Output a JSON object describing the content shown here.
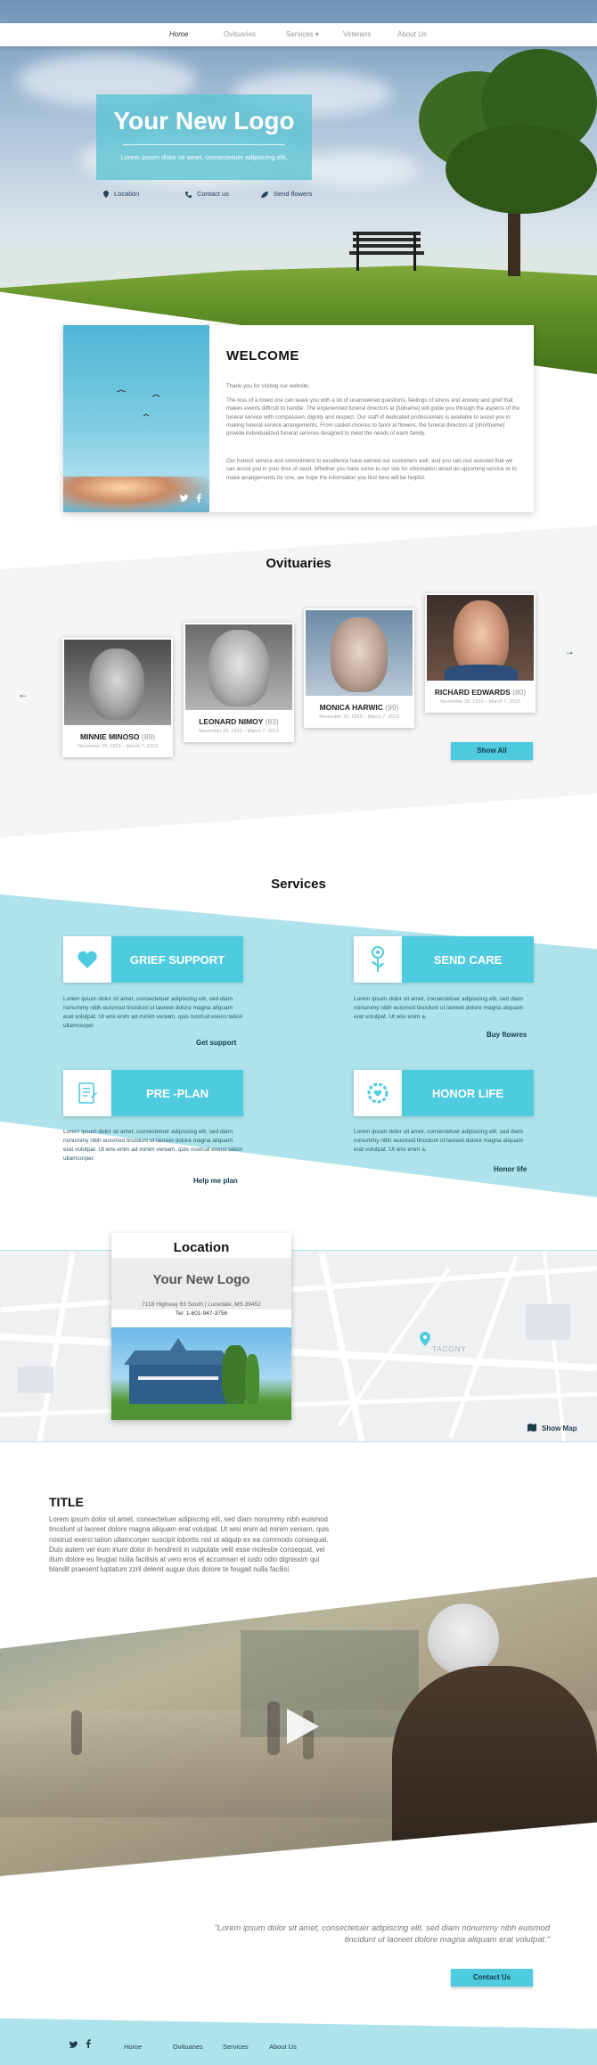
{
  "nav": {
    "items": [
      "Home",
      "Ovituaries",
      "Services",
      "Veterans",
      "About Us"
    ],
    "services_caret": "▾"
  },
  "hero": {
    "logo_title": "Your New Logo",
    "logo_subtitle": "Lorem ipsum dolor sit amet, consectetuer adipiscing elit,",
    "links": [
      "Location",
      "Contact us",
      "Send flowers"
    ]
  },
  "welcome": {
    "title": "WELCOME",
    "p1": "Thank you for visiting our website.",
    "p2": "The loss of a loved one can leave you with a lot of unanswered questions, feelings of stress and anxiety and grief that makes events difficult to handle. The experienced funeral directors at [fullname] will guide you through the aspects of the funeral service with compassion, dignity and respect. Our staff of dedicated professionals is available to assist you in making funeral service arrangements. From casket choices to fanor al flowers, the funeral directors at [shortname] provide individualized funeral services designed to meet the needs of each family.",
    "p3": "Our honest service and commitment to excellence have earned our customers well, and you can rest assured that we can assist you in your time of need. Whether you have come to our site for information about an upcoming service or to make arrangements for one, we hope the information you find here will be helpful."
  },
  "obituaries": {
    "title": "Ovituaries",
    "prev_arrow": "←",
    "next_arrow": "→",
    "show_all": "Show All",
    "people": [
      {
        "name": "MINNIE MINOSO",
        "age": "(89)",
        "dates": "November 29, 1923 – March 7, 2013"
      },
      {
        "name": "LEONARD NIMOY",
        "age": "(83)",
        "dates": "November 29, 1923 – March 7, 2013"
      },
      {
        "name": "MONICA HARWIC",
        "age": "(99)",
        "dates": "November 29, 1923 – March 7, 2013"
      },
      {
        "name": "RICHARD EDWARDS",
        "age": "(80)",
        "dates": "November 29, 1923 – March 7, 2013"
      }
    ]
  },
  "services": {
    "title": "Services",
    "items": [
      {
        "title": "GRIEF SUPPORT",
        "text": "Lorem ipsum dolor sit amet, consectetuer adipiscing elit, sed diam nonummy nibh euismod tincidunt ut laoreet dolore magna aliquam erat volutpat. Ut wisi enim ad minim veniam, quis nostrud exerci tation ullamcorper.",
        "link": "Get support"
      },
      {
        "title": "SEND CARE",
        "text": "Lorem ipsum dolor sit amet, consectetuer adipiscing elit, sed diam nonummy nibh euismod tincidunt ut laoreet dolore magna aliquam erat volutpat. Ut wisi enim a.",
        "link": "Buy flowres"
      },
      {
        "title": "PRE -PLAN",
        "text": "Lorem ipsum dolor sit amet, consectetuer adipiscing elit, sed diam nonummy nibh euismod tincidunt ut laoreet dolore magna aliquam erat volutpat. Ut wisi enim ad minim veniam, quis nostrud exerci tation ullamcorper.",
        "link": "Help me plan"
      },
      {
        "title": "HONOR LIFE",
        "text": "Lorem ipsum dolor sit amet, consectetuer adipiscing elit, sed diam nonummy nibh euismod tincidunt ut laoreet dolore magna aliquam erat volutpat. Ut wisi enim a.",
        "link": "Honor life"
      }
    ]
  },
  "location": {
    "title": "Location",
    "logo": "Your New Logo",
    "address": "7118 Highway 63 South | Lucedale, MS 39452",
    "phone": "Tel: 1-601-947-3756",
    "map_label": "TACONY",
    "show_map": "Show Map"
  },
  "article": {
    "title": "TITLE",
    "text": "Lorem ipsum dolor sit amet, consectetuer adipiscing elit, sed diam nonummy nibh euismod tincidunt ut laoreet dolore magna aliquam erat volutpat. Ut wisi enim ad minim veniam, quis nostrud exerci tation ullamcorper suscipit lobortis nisl ut aliquip ex ea commodo consequat. Duis autem vel eum iriure dolor in hendrerit in vulputate velit esse molestie consequat, vel illum dolore eu feugiat nulla facilisis at vero eros et accumsan et iusto odio dignissim qui blandit praesent luptatum zzril delenit augue duis dolore te feugait nulla facilisi."
  },
  "quote": {
    "text": "\"Lorem ipsum dolor sit amet, consectetuer adipiscing elit, sed diam nonummy nibh euismod tincidunt ut laoreet dolore magna aliquam erat volutpat.\"",
    "button": "Contact Us"
  },
  "footer": {
    "items": [
      "Home",
      "Ovituaries",
      "Services",
      "About Us"
    ]
  },
  "colors": {
    "accent": "#4fcbe0",
    "accent_light": "#aee3ec",
    "dark_teal": "#10394a"
  }
}
